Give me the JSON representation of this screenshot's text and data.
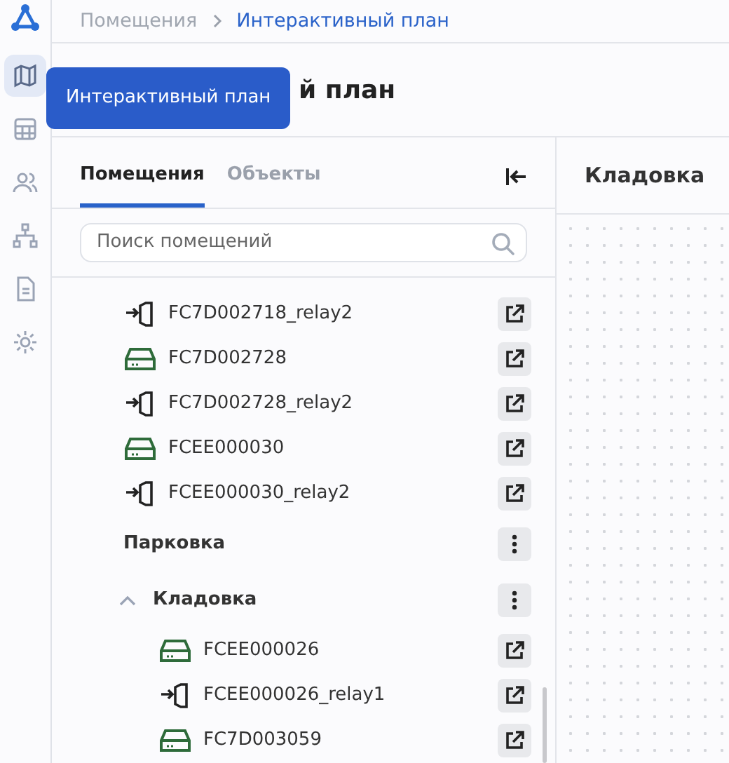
{
  "rail": [
    {
      "selected": true
    },
    {
      "selected": false
    },
    {
      "selected": false
    },
    {
      "selected": false
    },
    {
      "selected": false
    },
    {
      "selected": false
    }
  ],
  "tooltip": "Интерактивный план",
  "breadcrumbs": [
    {
      "label": "Помещения",
      "current": false
    },
    {
      "label": "Интерактивный план",
      "current": true
    }
  ],
  "page_title": "й план",
  "tabs": [
    {
      "label": "Помещения",
      "selected": true
    },
    {
      "label": "Объекты",
      "selected": false
    }
  ],
  "search": {
    "placeholder": "Поиск помещений"
  },
  "tree": [
    {
      "kind": "relay",
      "label": "FC7D002718_relay2"
    },
    {
      "kind": "device",
      "label": "FC7D002728"
    },
    {
      "kind": "relay",
      "label": "FC7D002728_relay2"
    },
    {
      "kind": "device",
      "label": "FCEE000030"
    },
    {
      "kind": "relay",
      "label": "FCEE000030_relay2"
    },
    {
      "kind": "room",
      "label": "Парковка"
    },
    {
      "kind": "room",
      "label": "Кладовка",
      "expanded": true,
      "children": [
        {
          "kind": "device",
          "label": "FCEE000026"
        },
        {
          "kind": "relay",
          "label": "FCEE000026_relay1"
        },
        {
          "kind": "device",
          "label": "FC7D003059"
        }
      ]
    }
  ],
  "plan_title": "Кладовка"
}
